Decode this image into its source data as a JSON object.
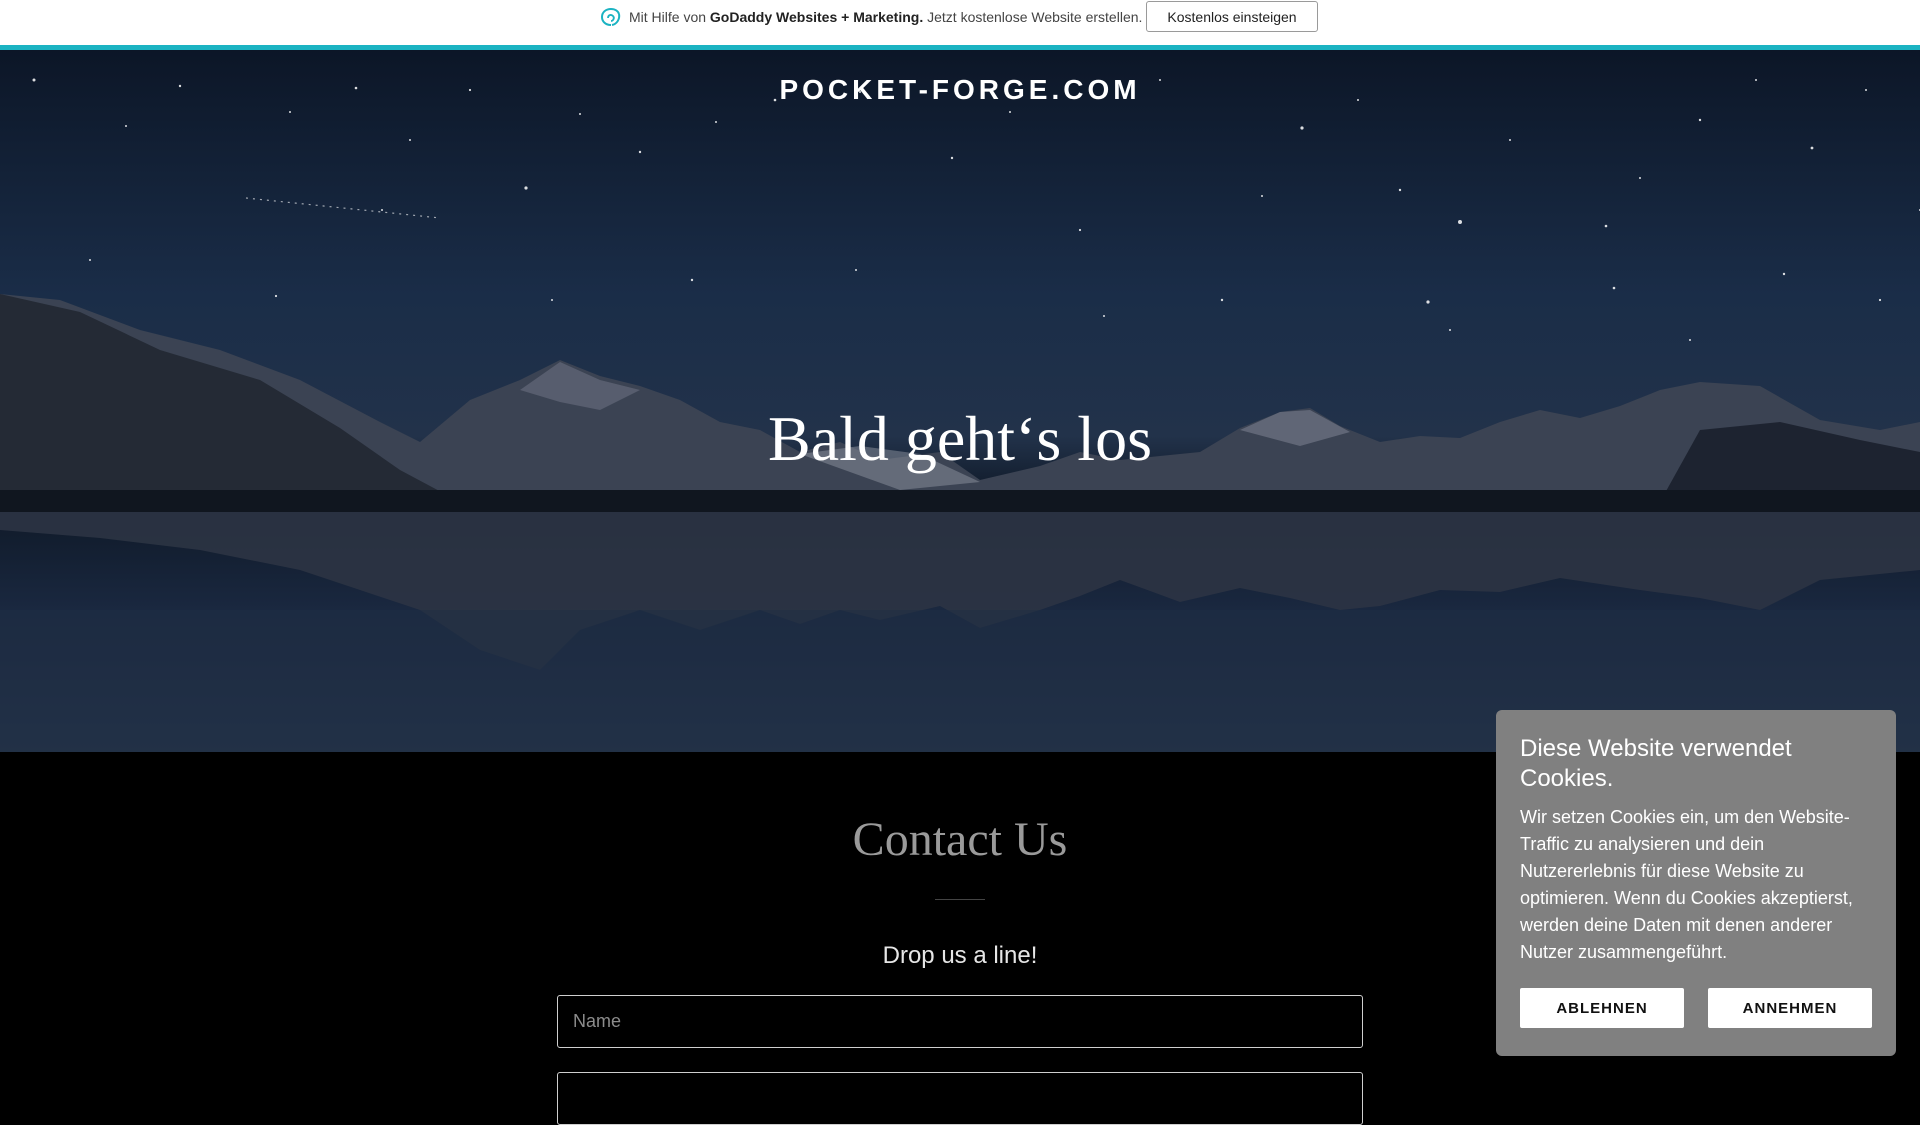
{
  "promo": {
    "prefix": "Mit Hilfe von ",
    "brand": "GoDaddy Websites + Marketing.",
    "suffix": " Jetzt kostenlose Website erstellen.",
    "cta": "Kostenlos einsteigen",
    "icon": "godaddy-logo-icon",
    "accent": "#1bb3c2"
  },
  "hero": {
    "site_title": "POCKET-FORGE.COM",
    "headline": "Bald geht‘s los"
  },
  "contact": {
    "title": "Contact Us",
    "subtitle": "Drop us a line!",
    "name_placeholder": "Name"
  },
  "cookie": {
    "title": "Diese Website verwendet Cookies.",
    "text": "Wir setzen Cookies ein, um den Website-Traffic zu analysieren und dein Nutzererlebnis für diese Website zu optimieren. Wenn du Cookies akzeptierst, werden deine Daten mit denen anderer Nutzer zusammengeführt.",
    "decline": "ABLEHNEN",
    "accept": "ANNEHMEN"
  }
}
